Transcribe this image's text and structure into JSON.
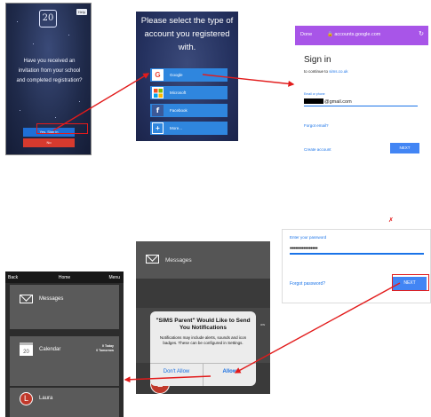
{
  "welcome_screen": {
    "logo": "20",
    "help": "Help",
    "question": "Have you received an invitation from your school and completed registration?",
    "yes_button": "Yes, Sign in",
    "no_button": "No"
  },
  "account_type": {
    "title": "Please select the type of account you registered with.",
    "options": [
      {
        "label": "Google",
        "icon": "google-icon",
        "color": "#ea4335"
      },
      {
        "label": "Microsoft",
        "icon": "microsoft-icon",
        "color": "#f25022"
      },
      {
        "label": "Facebook",
        "icon": "facebook-icon",
        "color": "#3b5998"
      },
      {
        "label": "More...",
        "icon": "plus-icon",
        "color": "#2f86de"
      }
    ]
  },
  "google_signin": {
    "done": "Done",
    "url": "🔒 accounts.google.com",
    "heading": "Sign in",
    "subtitle_prefix": "to continue to ",
    "subtitle_link": "sims.co.uk",
    "email_label": "Email or phone",
    "email_value": "@gmail.com",
    "forgot": "Forgot email?",
    "create": "Create account",
    "next": "NEXT"
  },
  "password_screen": {
    "label": "Enter your password",
    "value": "••••••••••••••••",
    "forgot": "Forgot password?",
    "next": "NEXT"
  },
  "home_screen": {
    "back": "Back",
    "title": "Home",
    "menu": "Menu",
    "messages": "Messages",
    "calendar": "Calendar",
    "calendar_day": "20",
    "today": "0 Today",
    "tomorrow": "0 Tomorrow",
    "contact_initial": "L",
    "contact_name": "Laura"
  },
  "notification": {
    "background_messages": "Messages",
    "background_day": "ow",
    "avatar_initial": "L",
    "title": "\"SIMS Parent\" Would Like to Send You Notifications",
    "body": "Notifications may include alerts, sounds and icon badges. These can be configured in Settings.",
    "deny": "Don't Allow",
    "allow": "Allow"
  },
  "annotation_mark": "✗",
  "colors": {
    "arrow": "#e21b1b",
    "google_header": "#a855e8",
    "google_blue": "#4285f4"
  }
}
